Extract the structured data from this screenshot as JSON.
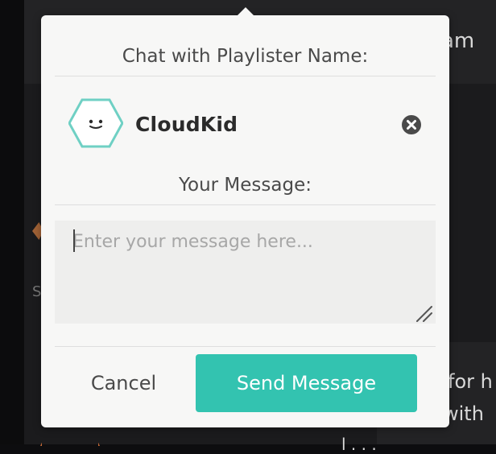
{
  "background": {
    "header_text_fragment": "am",
    "right_text_line1": "for h",
    "right_text_line2": "with",
    "right_text_line3": "l . . .",
    "left_text_fragment": "S"
  },
  "modal": {
    "title": "Chat with Playlister Name:",
    "recipient": {
      "name": "CloudKid",
      "avatar_icon": "hexagon-face-icon",
      "close_icon": "close-circle-icon"
    },
    "message_label": "Your Message:",
    "message_input": {
      "value": "",
      "placeholder": "Enter your message here..."
    },
    "cancel_label": "Cancel",
    "send_label": "Send Message"
  },
  "colors": {
    "accent": "#33c3b0",
    "avatar_stroke": "#6fd0c4",
    "modal_bg": "#f7f7f6",
    "input_bg": "#eeeeed",
    "text": "#4a4a4a",
    "close_icon": "#4a4a4a"
  }
}
